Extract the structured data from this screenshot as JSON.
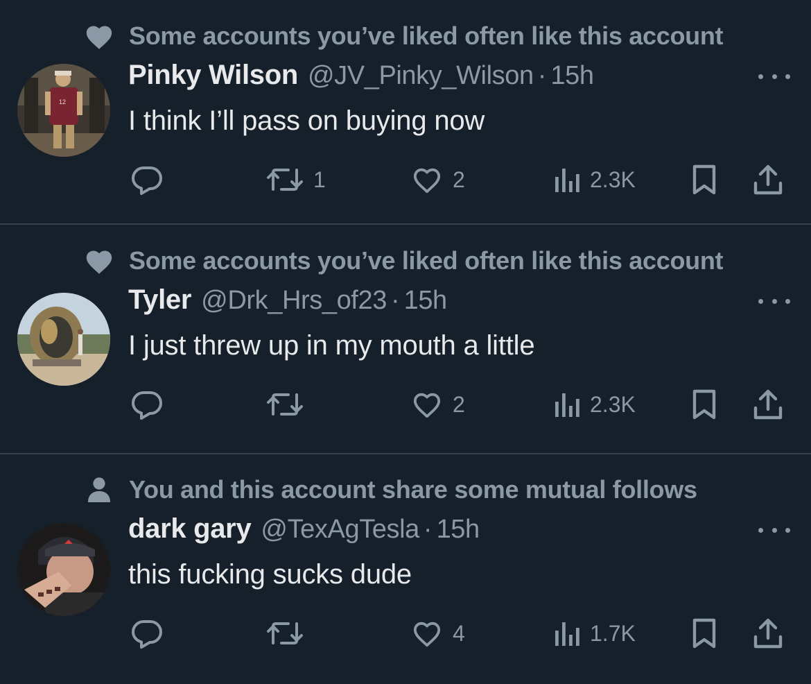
{
  "colors": {
    "background": "#15202b",
    "divider": "#38444d",
    "primary_text": "#e7e9ea",
    "secondary_text": "#8b98a5"
  },
  "tweets": [
    {
      "context_icon": "heart-icon",
      "context": "Some accounts you’ve liked often like this account",
      "name": "Pinky Wilson",
      "handle": "@JV_Pinky_Wilson",
      "dot": "·",
      "time": "15h",
      "text": "I think I’ll pass on buying now",
      "retweets": "1",
      "likes": "2",
      "views": "2.3K"
    },
    {
      "context_icon": "heart-icon",
      "context": "Some accounts you’ve liked often like this account",
      "name": "Tyler",
      "handle": "@Drk_Hrs_of23",
      "dot": "·",
      "time": "15h",
      "text": "I just threw up in my mouth a little",
      "retweets": "",
      "likes": "2",
      "views": "2.3K"
    },
    {
      "context_icon": "person-icon",
      "context": "You and this account share some mutual follows",
      "name": "dark gary",
      "handle": "@TexAgTesla",
      "dot": "·",
      "time": "15h",
      "text": "this fucking sucks dude",
      "retweets": "",
      "likes": "4",
      "views": "1.7K"
    }
  ]
}
